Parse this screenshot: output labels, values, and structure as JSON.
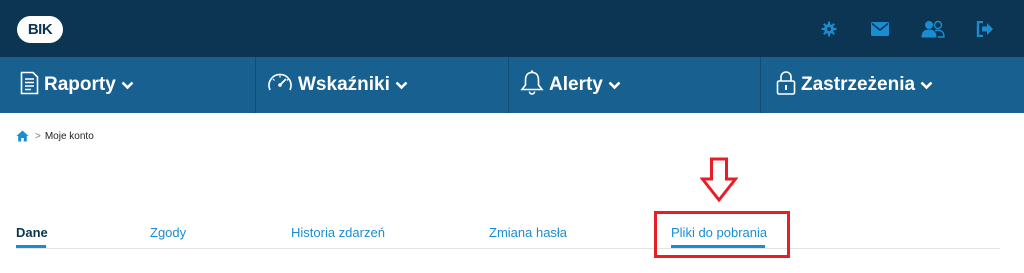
{
  "colors": {
    "topbar": "#0b3552",
    "navbar": "#17608f",
    "accent": "#1a8dd1",
    "annotation": "#e61e25"
  },
  "header": {
    "logo_text": "BIK",
    "icons": [
      "gear-icon",
      "mail-icon",
      "users-icon",
      "logout-icon"
    ]
  },
  "nav": {
    "items": [
      {
        "label": "Raporty",
        "icon": "document-icon"
      },
      {
        "label": "Wskaźniki",
        "icon": "gauge-icon"
      },
      {
        "label": "Alerty",
        "icon": "bell-icon"
      },
      {
        "label": "Zastrzeżenia",
        "icon": "lock-icon"
      }
    ]
  },
  "breadcrumb": {
    "home_icon": "home-icon",
    "separator": ">",
    "current": "Moje konto"
  },
  "tabs": {
    "items": [
      {
        "label": "Dane",
        "active": true
      },
      {
        "label": "Zgody",
        "active": false
      },
      {
        "label": "Historia zdarzeń",
        "active": false
      },
      {
        "label": "Zmiana hasła",
        "active": false
      },
      {
        "label": "Pliki do pobrania",
        "active": false
      }
    ]
  }
}
